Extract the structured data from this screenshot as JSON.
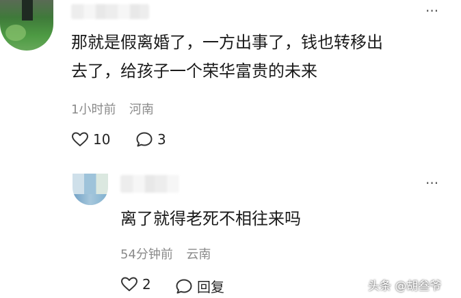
{
  "comment": {
    "text_line1": "那就是假离婚了，一方出事了，钱也转移出",
    "text_line2": "去了，给孩子一个荣华富贵的未来",
    "time": "1小时前",
    "location": "河南",
    "likes": "10",
    "replies": "3",
    "more_icon": "more-dots-icon"
  },
  "reply": {
    "text": "离了就得老死不相往来吗",
    "time": "54分钟前",
    "location": "云南",
    "likes": "2",
    "reply_label": "回复",
    "more_icon": "more-dots-icon"
  },
  "watermark": "头条 @胡叁爷",
  "colors": {
    "text": "#1a1a1a",
    "meta": "#8a8a8a",
    "icon": "#333333"
  }
}
